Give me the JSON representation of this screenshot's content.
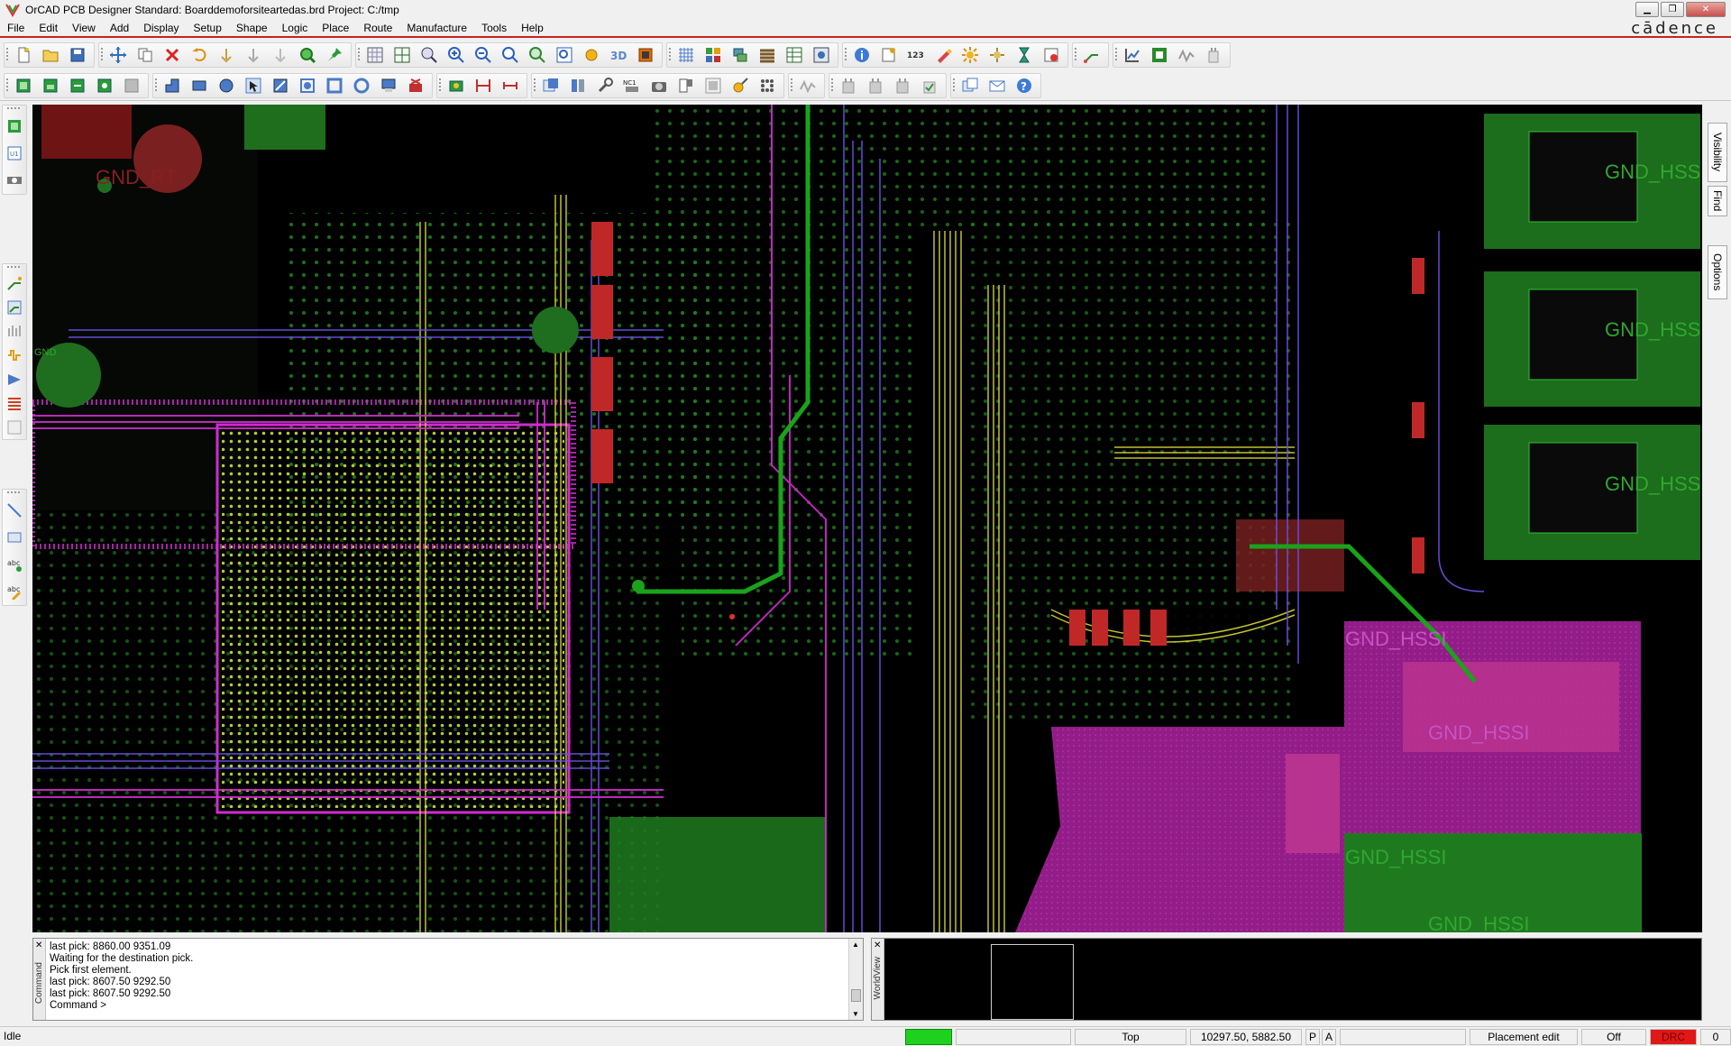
{
  "window": {
    "title": "OrCAD PCB Designer Standard: Boarddemoforsiteartedas.brd  Project: C:/tmp",
    "brand": "cādence"
  },
  "menu": [
    "File",
    "Edit",
    "View",
    "Add",
    "Display",
    "Setup",
    "Shape",
    "Logic",
    "Place",
    "Route",
    "Manufacture",
    "Tools",
    "Help"
  ],
  "side_tabs": [
    "Visibility",
    "Find",
    "Options"
  ],
  "canvas_labels": [
    "GND_RT",
    "GND_HSSI",
    "GND_HSSI",
    "GND_HSSI",
    "GND_HSSI",
    "GND_HSSI",
    "GND_HSSI",
    "GND_HSSI",
    "GND"
  ],
  "command_panel": {
    "label": "Command",
    "lines": [
      "last pick:  8860.00  9351.09",
      "Waiting for the destination pick.",
      "Pick first element.",
      "last pick:  8607.50  9292.50",
      "last pick:  8607.50  9292.50",
      "Command >"
    ]
  },
  "worldview": {
    "label": "WorldView"
  },
  "status": {
    "state": "Idle",
    "layer": "Top",
    "coords": "10297.50, 5882.50",
    "p": "P",
    "a": "A",
    "mode": "Placement edit",
    "off": "Off",
    "drc": "DRC",
    "count": "0"
  },
  "colors": {
    "accent_red": "#cc2020",
    "trace_green": "#1aa31a",
    "trace_magenta": "#d02bd0",
    "trace_yellow": "#d6d636",
    "trace_purple": "#6a4fe0"
  }
}
